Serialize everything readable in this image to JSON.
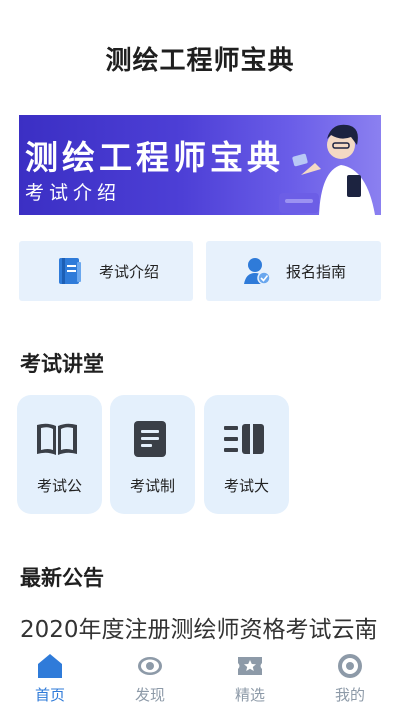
{
  "header": {
    "title": "测绘工程师宝典"
  },
  "banner": {
    "title": "测绘工程师宝典",
    "subtitle": "考试介绍"
  },
  "quick_links": [
    {
      "label": "考试介绍",
      "icon": "book-icon"
    },
    {
      "label": "报名指南",
      "icon": "user-verified-icon"
    }
  ],
  "lecture_section": {
    "title": "考试讲堂",
    "items": [
      {
        "label": "考试公",
        "icon": "open-book-icon"
      },
      {
        "label": "考试制",
        "icon": "document-icon"
      },
      {
        "label": "考试大",
        "icon": "outline-list-icon"
      }
    ]
  },
  "notice_section": {
    "title": "最新公告",
    "items": [
      {
        "text": "2020年度注册测绘师资格考试云南"
      }
    ]
  },
  "tabbar": {
    "active": "首页",
    "tabs": [
      {
        "label": "首页",
        "icon": "home-icon"
      },
      {
        "label": "发现",
        "icon": "eye-icon"
      },
      {
        "label": "精选",
        "icon": "star-ticket-icon"
      },
      {
        "label": "我的",
        "icon": "profile-icon"
      }
    ]
  },
  "colors": {
    "accent": "#2f7bd9",
    "card_bg": "#e7f1fc",
    "banner_bg": "#3b2fc4"
  }
}
